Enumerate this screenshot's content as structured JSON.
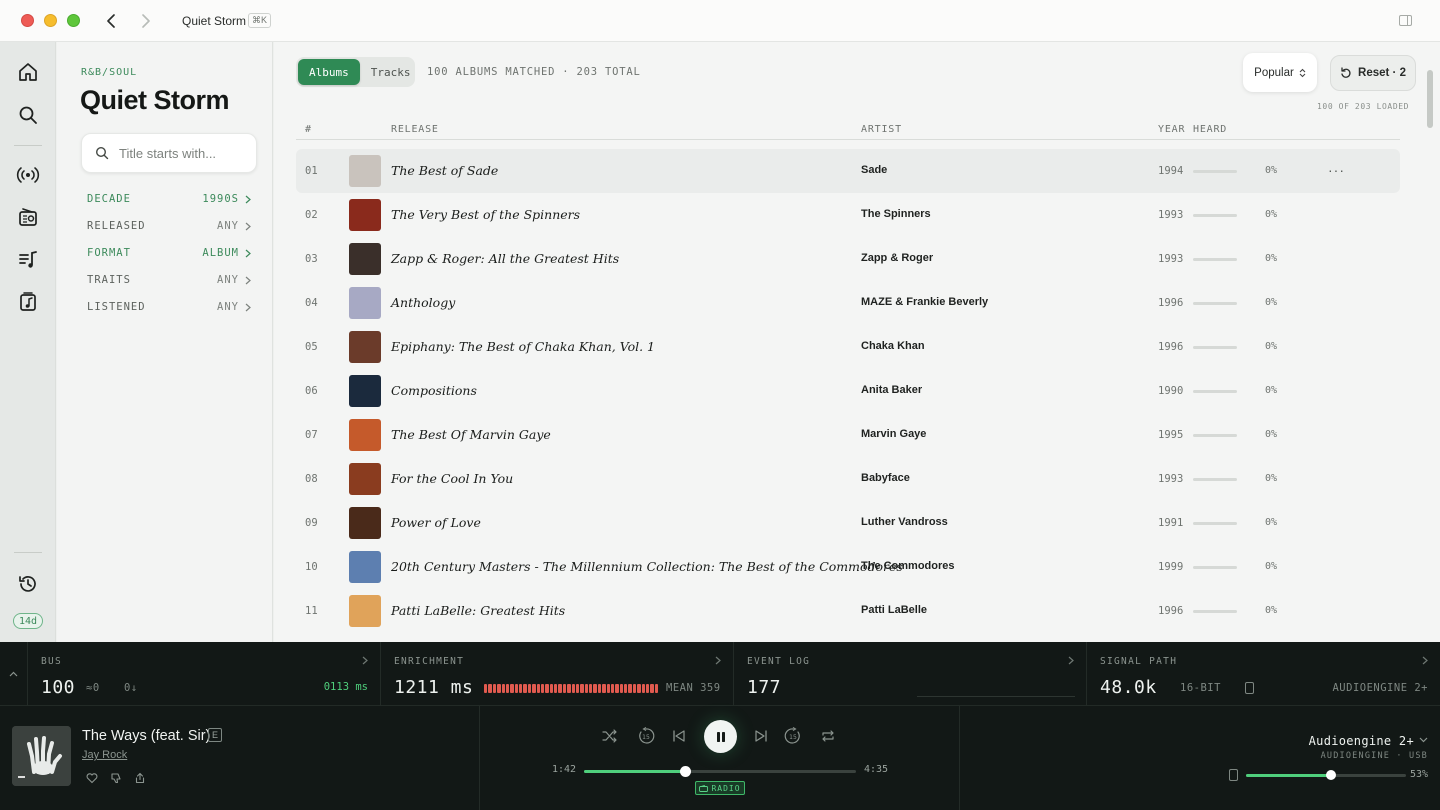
{
  "window": {
    "title": "Quiet Storm",
    "shortcut": "⌘K"
  },
  "rail": {
    "badge": "14d"
  },
  "sidebar": {
    "genre": "R&B/SOUL",
    "title": "Quiet Storm",
    "search_placeholder": "Title starts with...",
    "filters": [
      {
        "label": "DECADE",
        "value": "1990S",
        "active": true
      },
      {
        "label": "RELEASED",
        "value": "ANY",
        "active": false
      },
      {
        "label": "FORMAT",
        "value": "ALBUM",
        "active": true
      },
      {
        "label": "TRAITS",
        "value": "ANY",
        "active": false
      },
      {
        "label": "LISTENED",
        "value": "ANY",
        "active": false
      }
    ]
  },
  "main": {
    "tabs": [
      "Albums",
      "Tracks"
    ],
    "active_tab": "Albums",
    "match_info": "100 ALBUMS MATCHED · 203 TOTAL",
    "sort_label": "Popular",
    "reset_label": "Reset · 2",
    "loaded_info": "100 OF 203 LOADED",
    "columns": {
      "num": "#",
      "release": "RELEASE",
      "artist": "ARTIST",
      "year": "YEAR",
      "heard": "HEARD"
    },
    "rows": [
      {
        "num": "01",
        "release": "The Best of Sade",
        "artist": "Sade",
        "year": "1994",
        "heard": "0%",
        "cover": "#c9c3bd"
      },
      {
        "num": "02",
        "release": "The Very Best of the Spinners",
        "artist": "The Spinners",
        "year": "1993",
        "heard": "0%",
        "cover": "#8a2a1c"
      },
      {
        "num": "03",
        "release": "Zapp & Roger: All the Greatest Hits",
        "artist": "Zapp & Roger",
        "year": "1993",
        "heard": "0%",
        "cover": "#3a2f2a"
      },
      {
        "num": "04",
        "release": "Anthology",
        "artist": "MAZE & Frankie Beverly",
        "year": "1996",
        "heard": "0%",
        "cover": "#a7a9c4"
      },
      {
        "num": "05",
        "release": "Epiphany: The Best of Chaka Khan, Vol. 1",
        "artist": "Chaka Khan",
        "year": "1996",
        "heard": "0%",
        "cover": "#6b3b2a"
      },
      {
        "num": "06",
        "release": "Compositions",
        "artist": "Anita Baker",
        "year": "1990",
        "heard": "0%",
        "cover": "#1b2a3d"
      },
      {
        "num": "07",
        "release": "The Best Of Marvin Gaye",
        "artist": "Marvin Gaye",
        "year": "1995",
        "heard": "0%",
        "cover": "#c55a2b"
      },
      {
        "num": "08",
        "release": "For the Cool In You",
        "artist": "Babyface",
        "year": "1993",
        "heard": "0%",
        "cover": "#8a3c1f"
      },
      {
        "num": "09",
        "release": "Power of Love",
        "artist": "Luther Vandross",
        "year": "1991",
        "heard": "0%",
        "cover": "#4a2a1a"
      },
      {
        "num": "10",
        "release": "20th Century Masters - The Millennium Collection: The Best of the Commodores",
        "artist": "The Commodores",
        "year": "1999",
        "heard": "0%",
        "cover": "#5d7fb0"
      },
      {
        "num": "11",
        "release": "Patti LaBelle: Greatest Hits",
        "artist": "Patti LaBelle",
        "year": "1996",
        "heard": "0%",
        "cover": "#e0a35a"
      }
    ]
  },
  "stats": {
    "bus": {
      "title": "BUS",
      "value": "100",
      "a": "≈0",
      "b": "0↓",
      "ms": "0113 ms"
    },
    "enrichment": {
      "title": "ENRICHMENT",
      "value": "1211 ms",
      "mean": "MEAN 359"
    },
    "event_log": {
      "title": "EVENT LOG",
      "value": "177"
    },
    "signal_path": {
      "title": "SIGNAL PATH",
      "rate": "48.0k",
      "depth": "16-BIT",
      "device": "AUDIOENGINE 2+"
    }
  },
  "now_playing": {
    "title": "The Ways (feat. Sir)",
    "explicit": "E",
    "artist": "Jay Rock",
    "elapsed": "1:42",
    "duration": "4:35",
    "progress": 0.37,
    "badge": "RADIO"
  },
  "output": {
    "name": "Audioengine 2+",
    "sub": "AUDIOENGINE · USB",
    "volume_label": "53%",
    "volume": 0.53
  },
  "colors": {
    "accent": "#2f8a55",
    "accent_bright": "#4fcf7c",
    "meter": "#e05a4f",
    "player_bg": "#121816"
  }
}
